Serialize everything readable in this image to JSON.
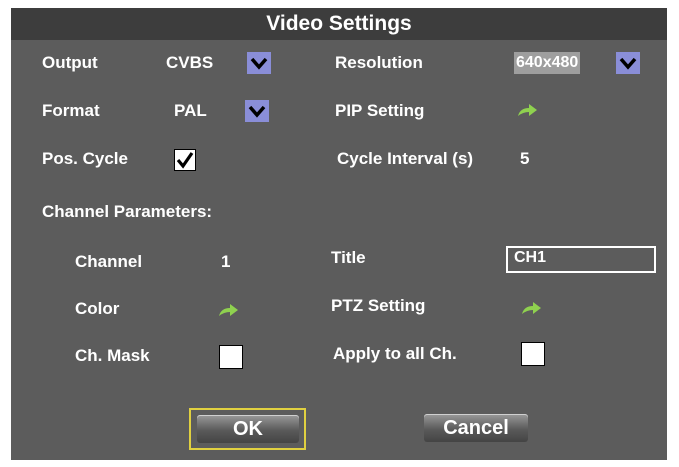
{
  "title": "Video Settings",
  "output": {
    "label": "Output",
    "value": "CVBS",
    "icon": "chevron-down-icon"
  },
  "resolution": {
    "label": "Resolution",
    "value": "640x480",
    "icon": "chevron-down-icon"
  },
  "format": {
    "label": "Format",
    "value": "PAL",
    "icon": "chevron-down-icon"
  },
  "pip": {
    "label": "PIP Setting",
    "icon": "enter-arrow-icon"
  },
  "pos_cycle": {
    "label": "Pos. Cycle",
    "checked": true
  },
  "cycle_interval": {
    "label": "Cycle Interval (s)",
    "value": "5"
  },
  "channel_params": {
    "heading": "Channel Parameters:",
    "channel": {
      "label": "Channel",
      "value": "1"
    },
    "title": {
      "label": "Title",
      "value": "CH1"
    },
    "color": {
      "label": "Color",
      "icon": "enter-arrow-icon"
    },
    "ptz": {
      "label": "PTZ Setting",
      "icon": "enter-arrow-icon"
    },
    "mask": {
      "label": "Ch. Mask",
      "checked": false
    },
    "apply_all": {
      "label": "Apply to all Ch.",
      "checked": false
    }
  },
  "buttons": {
    "ok": "OK",
    "cancel": "Cancel"
  },
  "colors": {
    "panel": "#5c5c5c",
    "titlebar": "#3d3d3d",
    "dropdown": "#8a8ed8",
    "arrow": "#8fd14f",
    "focus": "#e0d040"
  }
}
